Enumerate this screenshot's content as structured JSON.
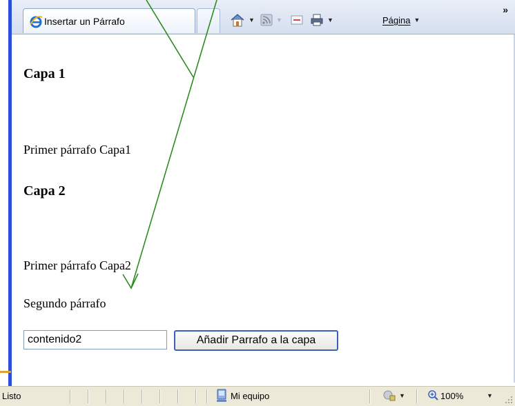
{
  "browser": {
    "tab_title": "Insertar un Párrafo",
    "page_menu_label": "Página",
    "overflow_glyph": "»"
  },
  "content": {
    "heading1": "Capa 1",
    "para1": "Primer párrafo Capa1",
    "heading2": "Capa 2",
    "para2": "Primer párrafo Capa2",
    "para3": "Segundo párrafo",
    "input_value": "contenido2",
    "button_label": "Añadir Parrafo a la capa"
  },
  "statusbar": {
    "status_text": "Listo",
    "zone_text": "Mi equipo",
    "zoom_text": "100%"
  },
  "icons": [
    "ie-icon",
    "home-icon",
    "feeds-icon",
    "mail-icon",
    "print-icon",
    "security-icon",
    "zoom-icon",
    "computer-icon"
  ],
  "colors": {
    "annotation_arrow": "#2e8b22",
    "accent_blue": "#2a4fd8",
    "button_border": "#3a5fb8"
  }
}
